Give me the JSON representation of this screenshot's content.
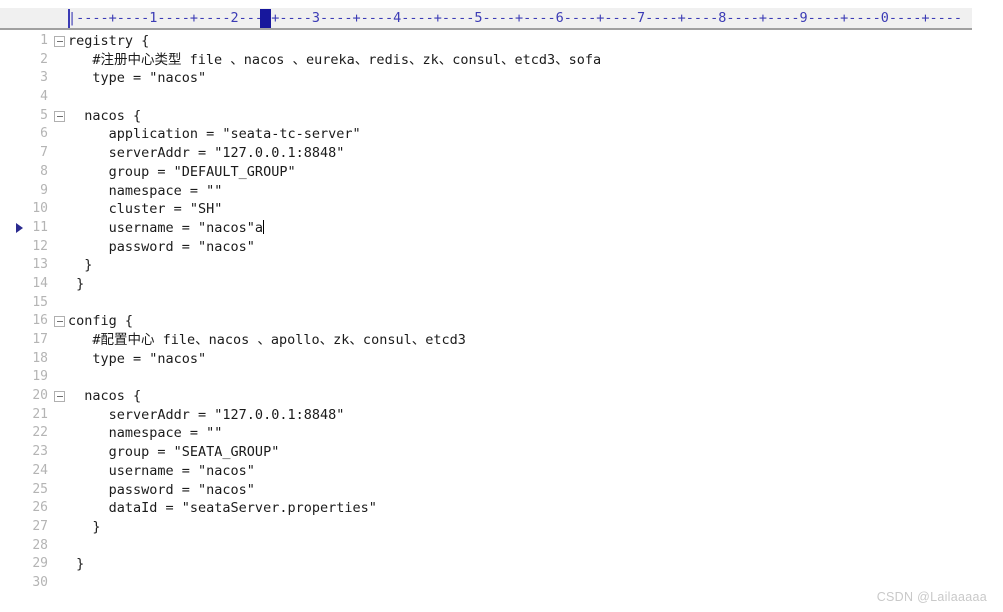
{
  "ruler": {
    "ticks": "|----+----1----+----2----+----3----+----4----+----5----+----6----+----7----+----8----+----9----+----0----+----",
    "cursor_column": 25
  },
  "editor": {
    "language": "conf",
    "caret_line": 11,
    "marker_line": 11,
    "lines": [
      {
        "n": "1",
        "fold": true,
        "text": "registry {"
      },
      {
        "n": "2",
        "fold": false,
        "text": "   #注册中心类型 file 、nacos 、eureka、redis、zk、consul、etcd3、sofa"
      },
      {
        "n": "3",
        "fold": false,
        "text": "   type = \"nacos\""
      },
      {
        "n": "4",
        "fold": false,
        "text": ""
      },
      {
        "n": "5",
        "fold": true,
        "text": "  nacos {"
      },
      {
        "n": "6",
        "fold": false,
        "text": "     application = \"seata-tc-server\""
      },
      {
        "n": "7",
        "fold": false,
        "text": "     serverAddr = \"127.0.0.1:8848\""
      },
      {
        "n": "8",
        "fold": false,
        "text": "     group = \"DEFAULT_GROUP\""
      },
      {
        "n": "9",
        "fold": false,
        "text": "     namespace = \"\""
      },
      {
        "n": "10",
        "fold": false,
        "text": "     cluster = \"SH\""
      },
      {
        "n": "11",
        "fold": false,
        "text": "     username = \"nacos\"a"
      },
      {
        "n": "12",
        "fold": false,
        "text": "     password = \"nacos\""
      },
      {
        "n": "13",
        "fold": false,
        "text": "  }"
      },
      {
        "n": "14",
        "fold": false,
        "text": " }"
      },
      {
        "n": "15",
        "fold": false,
        "text": ""
      },
      {
        "n": "16",
        "fold": true,
        "text": "config {"
      },
      {
        "n": "17",
        "fold": false,
        "text": "   #配置中心 file、nacos 、apollo、zk、consul、etcd3"
      },
      {
        "n": "18",
        "fold": false,
        "text": "   type = \"nacos\""
      },
      {
        "n": "19",
        "fold": false,
        "text": ""
      },
      {
        "n": "20",
        "fold": true,
        "text": "  nacos {"
      },
      {
        "n": "21",
        "fold": false,
        "text": "     serverAddr = \"127.0.0.1:8848\""
      },
      {
        "n": "22",
        "fold": false,
        "text": "     namespace = \"\""
      },
      {
        "n": "23",
        "fold": false,
        "text": "     group = \"SEATA_GROUP\""
      },
      {
        "n": "24",
        "fold": false,
        "text": "     username = \"nacos\""
      },
      {
        "n": "25",
        "fold": false,
        "text": "     password = \"nacos\""
      },
      {
        "n": "26",
        "fold": false,
        "text": "     dataId = \"seataServer.properties\""
      },
      {
        "n": "27",
        "fold": false,
        "text": "   }"
      },
      {
        "n": "28",
        "fold": false,
        "text": ""
      },
      {
        "n": "29",
        "fold": false,
        "text": " }"
      },
      {
        "n": "30",
        "fold": false,
        "text": ""
      }
    ]
  },
  "watermark": {
    "text": "CSDN @Lailaaaaa"
  },
  "colors": {
    "ruler_text": "#3b3bb5",
    "ruler_bg": "#f0f0f0",
    "cursor_block": "#17179c",
    "line_number": "#b4b4b4",
    "code_text": "#1b1b1b",
    "marker_arrow": "#2a2a8f",
    "watermark": "#c9c9c9"
  }
}
